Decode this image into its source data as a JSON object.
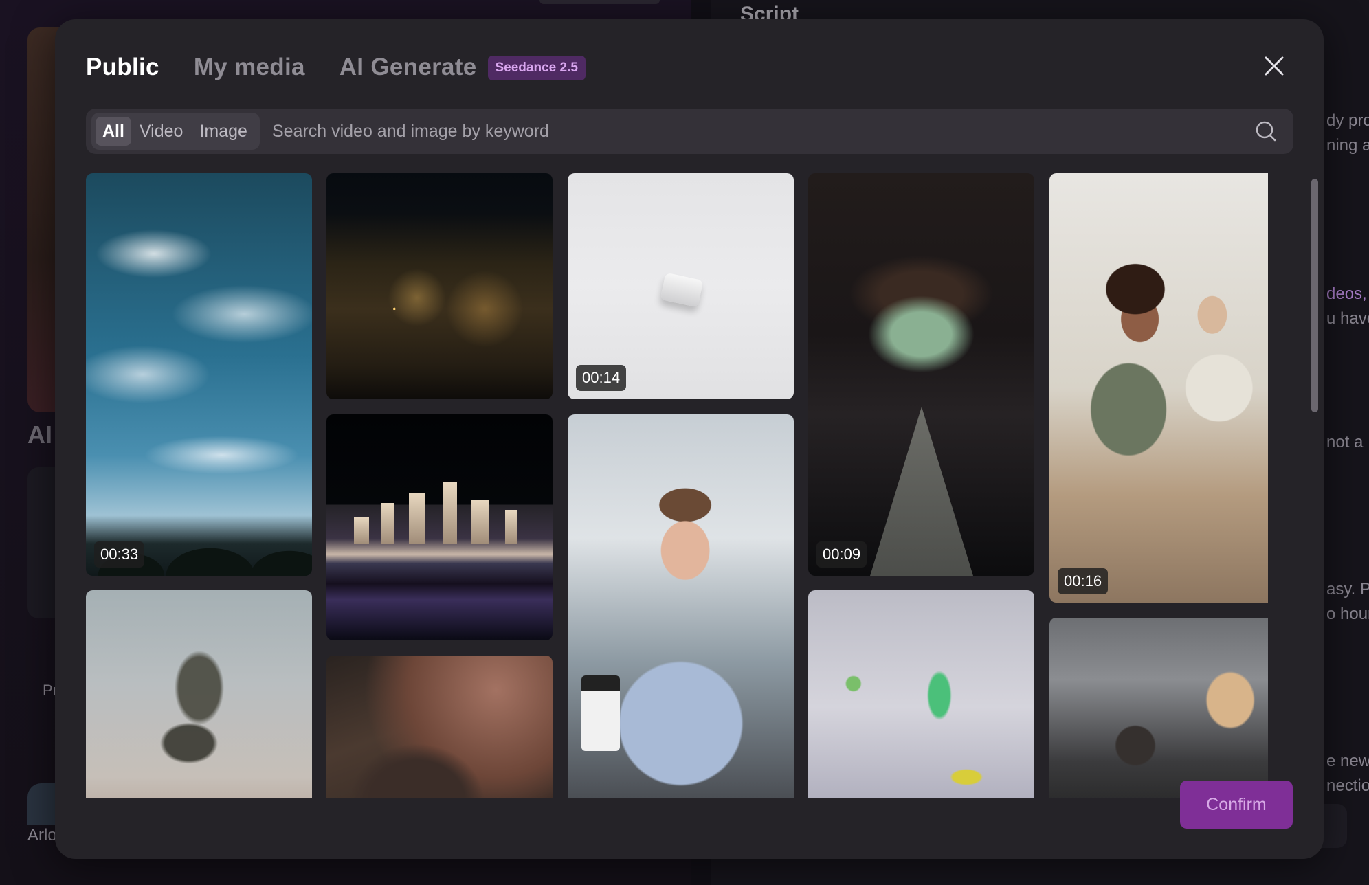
{
  "background": {
    "script_title": "Script",
    "section_label": "AI",
    "pu_label": "Pu",
    "user_name": "Arlo",
    "right_snippets": [
      "dy pro",
      "ning al",
      "deos,",
      "u have",
      "not a",
      "asy. Pe",
      "o hour",
      "e new",
      "nectio"
    ]
  },
  "modal": {
    "tabs": [
      {
        "label": "Public",
        "active": true
      },
      {
        "label": "My media",
        "active": false
      },
      {
        "label": "AI Generate",
        "active": false
      }
    ],
    "badge": "Seedance 2.5",
    "close_icon": "close-icon"
  },
  "search": {
    "filters": [
      {
        "label": "All",
        "active": true
      },
      {
        "label": "Video",
        "active": false
      },
      {
        "label": "Image",
        "active": false
      }
    ],
    "placeholder": "Search video and image by keyword",
    "icon": "search-icon"
  },
  "media": [
    {
      "name": "sky-clouds-video",
      "duration": "00:33"
    },
    {
      "name": "misty-tree-image",
      "duration": ""
    },
    {
      "name": "city-night-aerial-image",
      "duration": ""
    },
    {
      "name": "skyline-waterfront-image",
      "duration": ""
    },
    {
      "name": "woman-dots-image",
      "duration": ""
    },
    {
      "name": "white-device-video",
      "duration": "00:14"
    },
    {
      "name": "man-laptop-image",
      "duration": ""
    },
    {
      "name": "money-handcuffs-video",
      "duration": "00:09"
    },
    {
      "name": "glass-cubes-image",
      "duration": ""
    },
    {
      "name": "office-women-video",
      "duration": "00:16"
    },
    {
      "name": "blonde-office-image",
      "duration": ""
    }
  ],
  "footer": {
    "confirm_label": "Confirm"
  },
  "colors": {
    "accent": "#7f2f97",
    "badge_bg": "#4f2a63",
    "badge_text": "#d9a6ef"
  }
}
